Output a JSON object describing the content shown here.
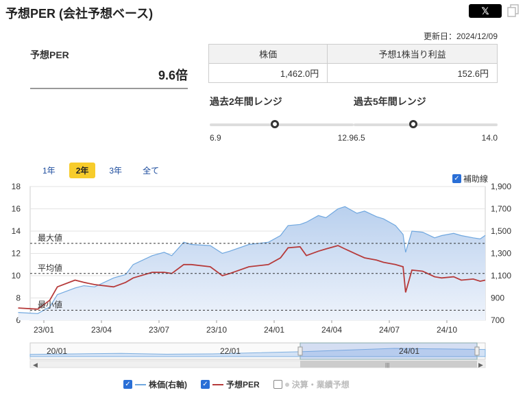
{
  "header": {
    "title": "予想PER (会社予想ベース)",
    "share_label": "𝕏",
    "updated": "更新日：2024/12/09"
  },
  "per": {
    "label": "予想PER",
    "value": "9.6倍"
  },
  "price_table": {
    "headers": [
      "株価",
      "予想1株当り利益"
    ],
    "values": [
      "1,462.0円",
      "152.6円"
    ]
  },
  "ranges": [
    {
      "label": "過去2年間レンジ",
      "min": "6.9",
      "max": "12.9",
      "current": 9.6,
      "lo": 6.9,
      "hi": 12.9
    },
    {
      "label": "過去5年間レンジ",
      "min": "6.5",
      "max": "14.0",
      "current": 9.6,
      "lo": 6.5,
      "hi": 14.0
    }
  ],
  "period_tabs": [
    "1年",
    "2年",
    "3年",
    "全て"
  ],
  "active_tab": "2年",
  "aux_label": "補助線",
  "legend": {
    "price": "株価(右軸)",
    "per": "予想PER",
    "earnings": "決算・業績予想"
  },
  "colors": {
    "price_line": "#6fa7df",
    "price_fill": "#c9dbf2",
    "per_line": "#b63a3a",
    "accent": "#f7cc2b",
    "checkbox": "#2a6fd6"
  },
  "chart_data": {
    "type": "line",
    "x_labels": [
      "23/01",
      "23/04",
      "23/07",
      "23/10",
      "24/01",
      "24/04",
      "24/07",
      "24/10"
    ],
    "y_left": {
      "ticks": [
        6,
        8,
        10,
        12,
        14,
        16,
        18
      ],
      "min": 6,
      "max": 18
    },
    "y_right": {
      "ticks": [
        "700",
        "900",
        "1,100",
        "1,300",
        "1,500",
        "1,700",
        "1,900"
      ],
      "min": 700,
      "max": 1900
    },
    "reference_lines": [
      {
        "label": "最大値",
        "value": 12.9
      },
      {
        "label": "平均値",
        "value": 10.2
      },
      {
        "label": "最小値",
        "value": 6.9
      }
    ],
    "series": [
      {
        "name": "株価(右軸)",
        "axis": "right",
        "style": "area",
        "points": [
          [
            "2022-12",
            770
          ],
          [
            "2023-01",
            760
          ],
          [
            "2023-01-20",
            820
          ],
          [
            "2023-02",
            930
          ],
          [
            "2023-03",
            990
          ],
          [
            "2023-03-15",
            1010
          ],
          [
            "2023-04",
            1000
          ],
          [
            "2023-05",
            1080
          ],
          [
            "2023-05-20",
            1110
          ],
          [
            "2023-06",
            1200
          ],
          [
            "2023-07",
            1280
          ],
          [
            "2023-07-20",
            1310
          ],
          [
            "2023-08",
            1280
          ],
          [
            "2023-08-20",
            1400
          ],
          [
            "2023-09",
            1380
          ],
          [
            "2023-10",
            1370
          ],
          [
            "2023-10-20",
            1300
          ],
          [
            "2023-11",
            1320
          ],
          [
            "2023-12",
            1380
          ],
          [
            "2024-01",
            1400
          ],
          [
            "2024-01-20",
            1460
          ],
          [
            "2024-02",
            1550
          ],
          [
            "2024-02-20",
            1560
          ],
          [
            "2024-03",
            1580
          ],
          [
            "2024-03-20",
            1640
          ],
          [
            "2024-04",
            1620
          ],
          [
            "2024-04-20",
            1700
          ],
          [
            "2024-05",
            1720
          ],
          [
            "2024-05-20",
            1660
          ],
          [
            "2024-06",
            1680
          ],
          [
            "2024-06-20",
            1630
          ],
          [
            "2024-07",
            1610
          ],
          [
            "2024-07-20",
            1550
          ],
          [
            "2024-08",
            1470
          ],
          [
            "2024-08-05",
            1310
          ],
          [
            "2024-08-15",
            1500
          ],
          [
            "2024-09",
            1490
          ],
          [
            "2024-09-20",
            1440
          ],
          [
            "2024-10",
            1460
          ],
          [
            "2024-10-20",
            1480
          ],
          [
            "2024-11",
            1460
          ],
          [
            "2024-11-20",
            1440
          ],
          [
            "2024-12",
            1430
          ],
          [
            "2024-12-09",
            1462
          ]
        ]
      },
      {
        "name": "予想PER",
        "axis": "left",
        "style": "line",
        "points": [
          [
            "2022-12",
            7.1
          ],
          [
            "2023-01",
            7.0
          ],
          [
            "2023-01-20",
            7.8
          ],
          [
            "2023-02",
            9.0
          ],
          [
            "2023-03",
            9.6
          ],
          [
            "2023-03-15",
            9.4
          ],
          [
            "2023-04",
            9.2
          ],
          [
            "2023-05",
            9.0
          ],
          [
            "2023-05-20",
            9.4
          ],
          [
            "2023-06",
            9.8
          ],
          [
            "2023-07",
            10.3
          ],
          [
            "2023-07-20",
            10.3
          ],
          [
            "2023-08",
            10.2
          ],
          [
            "2023-08-20",
            11.0
          ],
          [
            "2023-09",
            11.0
          ],
          [
            "2023-10",
            10.8
          ],
          [
            "2023-10-20",
            10.0
          ],
          [
            "2023-11",
            10.2
          ],
          [
            "2023-12",
            10.8
          ],
          [
            "2024-01",
            11.0
          ],
          [
            "2024-01-20",
            11.6
          ],
          [
            "2024-02",
            12.5
          ],
          [
            "2024-02-20",
            12.6
          ],
          [
            "2024-03",
            11.8
          ],
          [
            "2024-03-20",
            12.2
          ],
          [
            "2024-04",
            12.4
          ],
          [
            "2024-04-20",
            12.7
          ],
          [
            "2024-05",
            12.4
          ],
          [
            "2024-05-20",
            11.9
          ],
          [
            "2024-06",
            11.6
          ],
          [
            "2024-06-20",
            11.4
          ],
          [
            "2024-07",
            11.2
          ],
          [
            "2024-07-20",
            11.0
          ],
          [
            "2024-08",
            10.8
          ],
          [
            "2024-08-05",
            8.5
          ],
          [
            "2024-08-15",
            10.5
          ],
          [
            "2024-09",
            10.4
          ],
          [
            "2024-09-20",
            9.9
          ],
          [
            "2024-10",
            9.8
          ],
          [
            "2024-10-20",
            9.9
          ],
          [
            "2024-11",
            9.6
          ],
          [
            "2024-11-20",
            9.7
          ],
          [
            "2024-12",
            9.5
          ],
          [
            "2024-12-09",
            9.6
          ]
        ]
      }
    ],
    "navigator": {
      "labels": [
        "20/01",
        "22/01",
        "24/01"
      ]
    },
    "grid": true
  }
}
